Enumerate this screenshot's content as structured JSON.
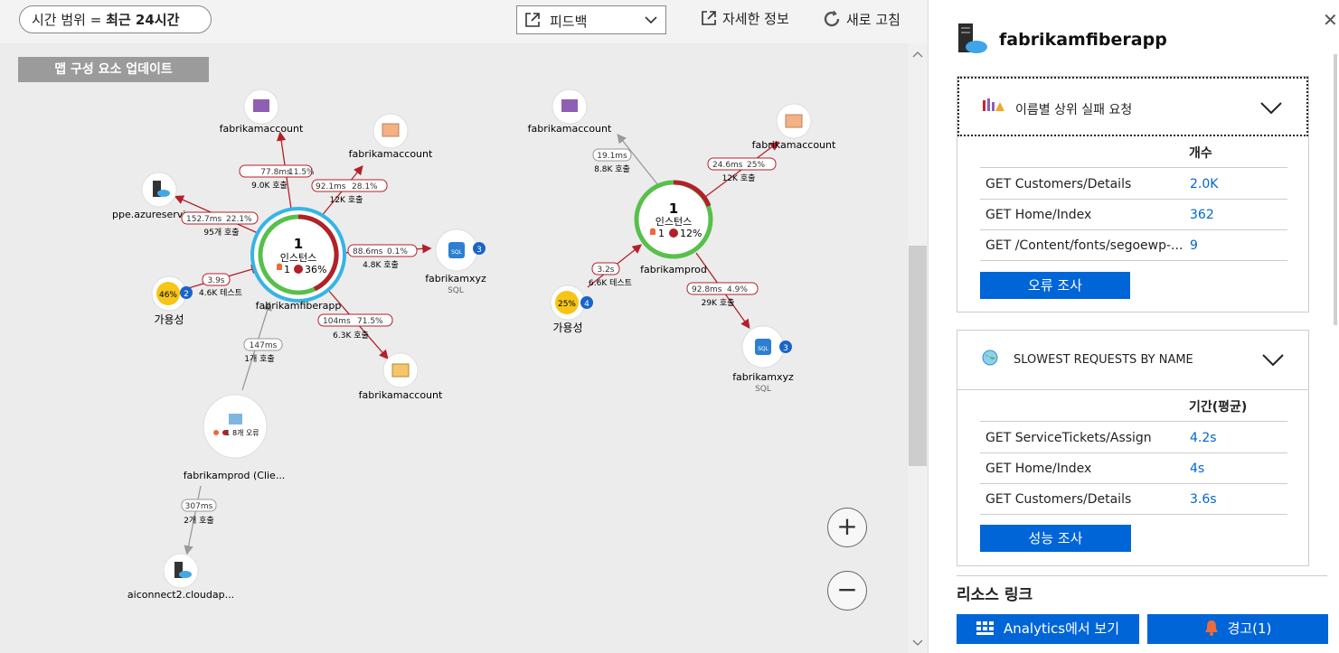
{
  "topbar": {
    "time_label": "시간 범위 = ",
    "time_value": "최근 24시간",
    "feedback": "피드백",
    "details": "자세한 정보",
    "refresh": "새로 고침"
  },
  "map": {
    "update_button": "맵 구성 요소 업데이트",
    "nodes": {
      "fab_main": {
        "count": "1",
        "label": "인스턴스",
        "alerts": "1",
        "errors": "36%",
        "name": "fabrikamfiberapp"
      },
      "fab_prod": {
        "count": "1",
        "label": "인스턴스",
        "alerts": "1",
        "errors": "12%",
        "name": "fabrikamprod"
      },
      "storage_top": {
        "name": "fabrikamaccount"
      },
      "storage_right": {
        "name": "fabrikamaccount"
      },
      "storage_bottom": {
        "name": "fabrikamaccount"
      },
      "storage_prod_top": {
        "name": "fabrikamaccount"
      },
      "storage_prod_right": {
        "name": "fabrikamaccount"
      },
      "ppe": {
        "name": "ppe.azureservicepe"
      },
      "sql1": {
        "name": "fabrikamxyz",
        "sub": "SQL",
        "badge": "3"
      },
      "sql2": {
        "name": "fabrikamxyz",
        "sub": "SQL",
        "badge": "3"
      },
      "avail1": {
        "percent": "46%",
        "badge": "2",
        "name": "가용성"
      },
      "avail2": {
        "percent": "25%",
        "badge": "4",
        "name": "가용성"
      },
      "client": {
        "status": "1 8개 오류",
        "name": "fabrikamprod (Clie..."
      },
      "aiconnect": {
        "name": "aiconnect2.cloudap..."
      }
    },
    "edges": {
      "e1": {
        "time": "77.8ms",
        "pct": "11.5%",
        "calls": "9.0K 호출"
      },
      "e2": {
        "time": "92.1ms",
        "pct": "28.1%",
        "calls": "12K 호출"
      },
      "e3": {
        "time": "152.7ms",
        "pct": "22.1%",
        "calls": "95개 호출"
      },
      "e4": {
        "time": "88.6ms",
        "pct": "0.1%",
        "calls": "4.8K 호출"
      },
      "e5": {
        "time": "3.9s",
        "calls": "4.6K 테스트"
      },
      "e6": {
        "time": "104ms",
        "pct": "71.5%",
        "calls": "6.3K 호출"
      },
      "e7": {
        "time": "147ms",
        "calls": "1개 호출"
      },
      "e8": {
        "time": "307ms",
        "calls": "2개 호출"
      },
      "p1": {
        "time": "19.1ms",
        "calls": "8.8K 호출"
      },
      "p2": {
        "time": "24.6ms",
        "pct": "25%",
        "calls": "12K 호출"
      },
      "p3": {
        "time": "3.2s",
        "calls": "6.6K 테스트"
      },
      "p4": {
        "time": "92.8ms",
        "pct": "4.9%",
        "calls": "29K 호출"
      }
    },
    "zoom_in": "+",
    "zoom_out": "−"
  },
  "panel": {
    "title": "fabrikamfiberapp",
    "failed": {
      "title": "이름별 상위 실패 요청",
      "col_header": "개수",
      "rows": [
        {
          "name": "GET Customers/Details",
          "value": "2.0K"
        },
        {
          "name": "GET Home/Index",
          "value": "362"
        },
        {
          "name": "GET /Content/fonts/segoewp-...",
          "value": "9"
        }
      ],
      "button": "오류 조사"
    },
    "slow": {
      "title": "SLOWEST REQUESTS BY NAME",
      "col_header": "기간(평균)",
      "rows": [
        {
          "name": "GET ServiceTickets/Assign",
          "value": "4.2s"
        },
        {
          "name": "GET Home/Index",
          "value": "4s"
        },
        {
          "name": "GET Customers/Details",
          "value": "3.6s"
        }
      ],
      "button": "성능 조사"
    },
    "resource_links": "리소스 링크",
    "analytics_button": "Analytics에서 보기",
    "alerts_button": "경고(1)"
  },
  "colors": {
    "accent": "#0065d7",
    "error": "#c4262e",
    "healthy": "#57c04b",
    "selected_ring": "#35b5e5",
    "availability": "#f5c518"
  }
}
